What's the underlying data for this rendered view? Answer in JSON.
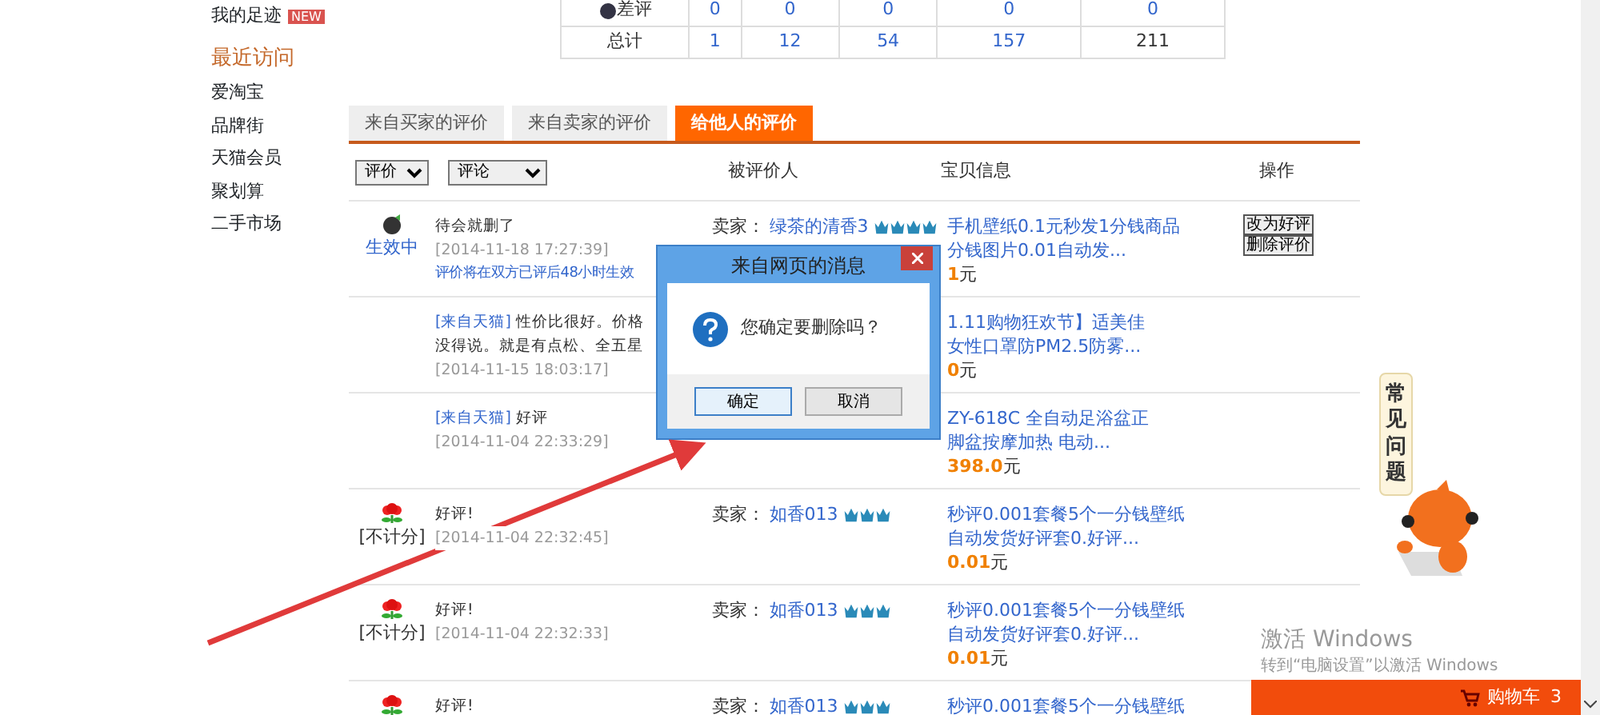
{
  "sidebar": {
    "footprint": {
      "label": "我的足迹",
      "badge": "NEW"
    },
    "recent_title": "最近访问",
    "items": [
      "爱淘宝",
      "品牌街",
      "天猫会员",
      "聚划算",
      "二手市场"
    ]
  },
  "stats": {
    "rows": [
      {
        "label": "差评",
        "kind": "bad",
        "values": [
          "0",
          "0",
          "0",
          "0",
          "0"
        ]
      },
      {
        "label": "总计",
        "kind": "total",
        "values": [
          "1",
          "12",
          "54",
          "157",
          "211"
        ]
      }
    ]
  },
  "tabs": [
    {
      "label": "来自买家的评价",
      "selected": false
    },
    {
      "label": "来自卖家的评价",
      "selected": false
    },
    {
      "label": "给他人的评价",
      "selected": true
    }
  ],
  "filters": [
    {
      "value": "评价"
    },
    {
      "value": "评论"
    }
  ],
  "columns": [
    "被评价人",
    "宝贝信息",
    "操作"
  ],
  "reviews": [
    {
      "kind": "bad",
      "status": "生效中",
      "comment": "待会就删了",
      "date": "[2014-11-18 17:27:39]",
      "note": "评价将在双方已评后48小时生效",
      "seller_label": "卖家：",
      "seller": "绿茶的清香3",
      "stars": 4,
      "item_lines": [
        "手机壁纸0.1元秒发1分钱商品",
        "分钱图片0.01自动发..."
      ],
      "price": "1",
      "currency": "元",
      "actions": [
        "改为好评",
        "删除评价"
      ]
    },
    {
      "source": "[来自天猫]",
      "comment": "性价比很好。价格没得说。就是有点松、全五星",
      "date": "[2014-11-15 18:03:17]",
      "item_lines": [
        "1.11购物狂欢节】适美佳",
        "女性口罩防PM2.5防雾..."
      ],
      "price": "0",
      "currency": "元"
    },
    {
      "source": "[来自天猫]",
      "comment": "好评",
      "date": "[2014-11-04 22:33:29]",
      "item_lines": [
        "ZY-618C 全自动足浴盆正",
        "脚盆按摩加热 电动..."
      ],
      "price": "398.0",
      "currency": "元"
    },
    {
      "kind": "flower",
      "status": "[不计分]",
      "comment": "好评!",
      "date": "[2014-11-04 22:32:45]",
      "seller_label": "卖家：",
      "seller": "如香013",
      "stars": 3,
      "item_lines": [
        "秒评0.001套餐5个一分钱壁纸",
        "自动发货好评套0.好评..."
      ],
      "price": "0.01",
      "currency": "元"
    },
    {
      "kind": "flower",
      "status": "[不计分]",
      "comment": "好评!",
      "date": "[2014-11-04 22:32:33]",
      "seller_label": "卖家：",
      "seller": "如香013",
      "stars": 3,
      "item_lines": [
        "秒评0.001套餐5个一分钱壁纸",
        "自动发货好评套0.好评..."
      ],
      "price": "0.01",
      "currency": "元"
    },
    {
      "kind": "flower",
      "comment": "好评!",
      "seller_label": "卖家：",
      "seller": "如香013",
      "stars": 3,
      "item_lines": [
        "秒评0.001套餐5个一分钱壁纸"
      ]
    }
  ],
  "dialog": {
    "title": "来自网页的消息",
    "message": "您确定要删除吗？",
    "buttons": [
      {
        "label": "确定",
        "default": true
      },
      {
        "label": "取消",
        "default": false
      }
    ]
  },
  "help_tab": {
    "label": "常见问题"
  },
  "cart": {
    "label": "购物车",
    "count": "3"
  },
  "os_overlay": {
    "title": "激活 Windows",
    "hint": "转到“电脑设置”以激活 Windows"
  }
}
